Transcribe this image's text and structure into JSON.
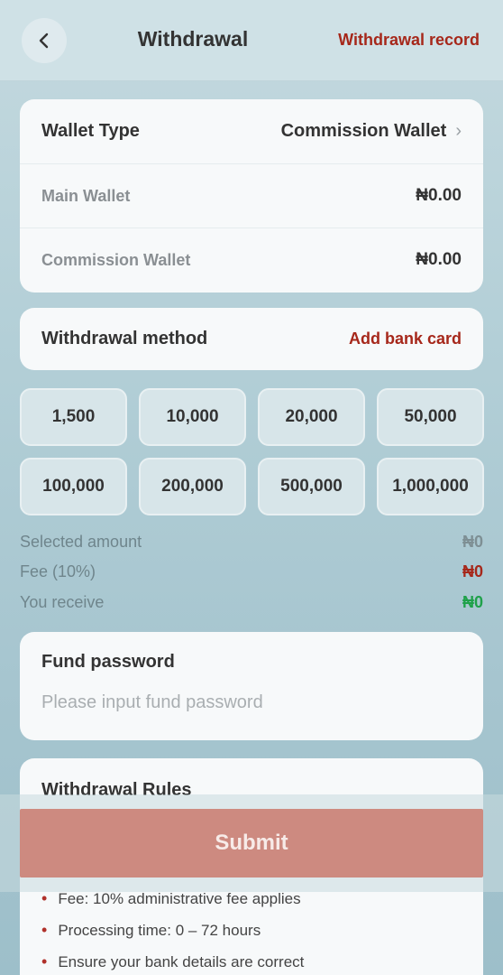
{
  "header": {
    "title": "Withdrawal",
    "record_link": "Withdrawal record",
    "back_icon": "chevron-left-icon"
  },
  "wallet": {
    "type_label": "Wallet Type",
    "type_value": "Commission Wallet",
    "main_label": "Main Wallet",
    "main_value": "₦0.00",
    "commission_label": "Commission Wallet",
    "commission_value": "₦0.00"
  },
  "method": {
    "label": "Withdrawal method",
    "add_link": "Add bank card"
  },
  "amounts": [
    "1,500",
    "10,000",
    "20,000",
    "50,000",
    "100,000",
    "200,000",
    "500,000",
    "1,000,000"
  ],
  "summary": {
    "selected_label": "Selected amount",
    "selected_value": "₦0",
    "fee_label": "Fee (10%)",
    "fee_value": "₦0",
    "receive_label": "You receive",
    "receive_value": "₦0"
  },
  "fund_password": {
    "label": "Fund password",
    "placeholder": "Please input fund password"
  },
  "rules": {
    "title": "Withdrawal Rules",
    "items": [
      "Fee: 10% administrative fee applies",
      "Processing time: 0 – 72 hours",
      "Ensure your bank details are correct"
    ]
  },
  "submit_label": "Submit",
  "colors": {
    "accent_red": "#a6271a",
    "green": "#1fa14a",
    "submit_bg": "#cd8a80"
  }
}
